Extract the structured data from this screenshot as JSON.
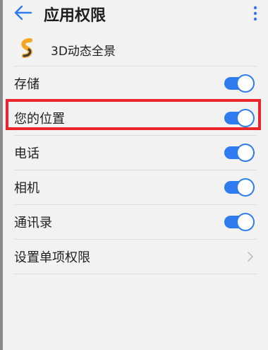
{
  "appbar": {
    "title": "应用权限"
  },
  "app": {
    "name": "3D动态全景"
  },
  "permissions": [
    {
      "label": "存储",
      "enabled": true
    },
    {
      "label": "您的位置",
      "enabled": true
    },
    {
      "label": "电话",
      "enabled": true
    },
    {
      "label": "相机",
      "enabled": true
    },
    {
      "label": "通讯录",
      "enabled": true
    }
  ],
  "single_permission": {
    "label": "设置单项权限"
  },
  "colors": {
    "accent": "#2f7bf0",
    "highlight": "#e8262b",
    "app_icon": "#f5a623"
  }
}
